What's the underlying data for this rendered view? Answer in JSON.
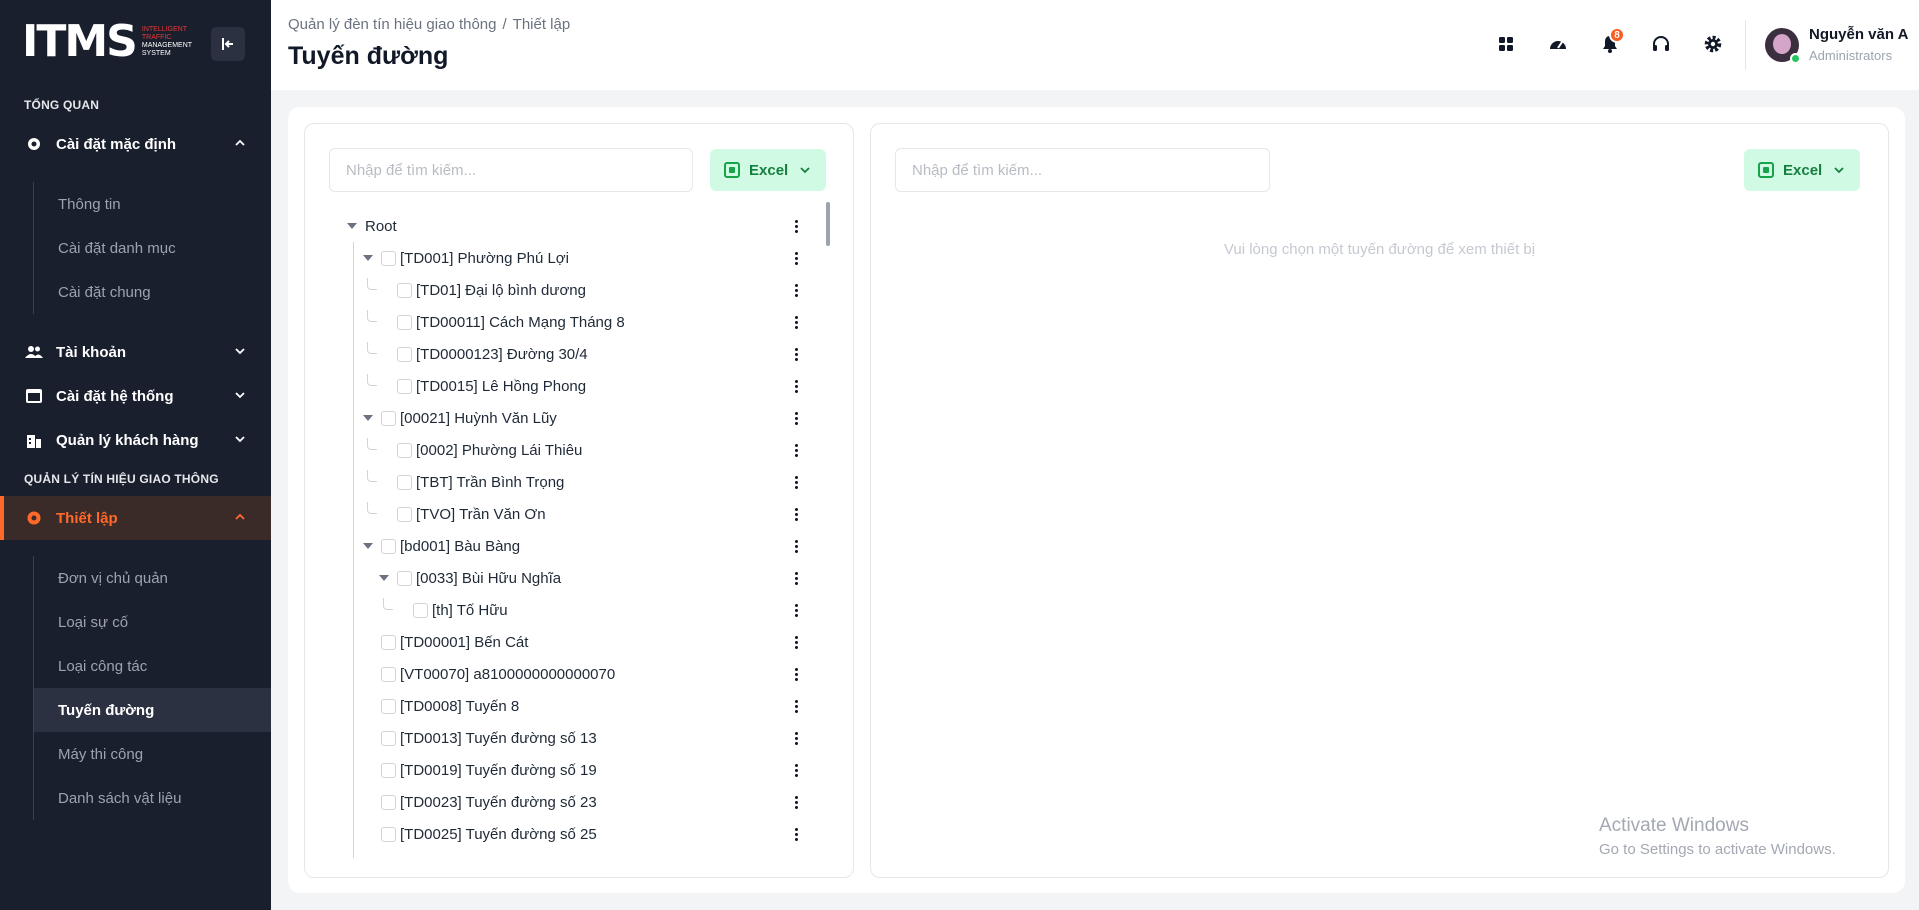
{
  "logo": {
    "text_main": "IT",
    "text_accent": "MS",
    "line1": "INTELLIGENT",
    "line2": "TRAFFIC",
    "line3": "MANAGEMENT",
    "line4": "SYSTEM"
  },
  "sidebar": {
    "section_overview": "TỔNG QUAN",
    "default_settings": "Cài đặt mặc định",
    "default_settings_items": [
      "Thông tin",
      "Cài đặt danh mục",
      "Cài đặt chung"
    ],
    "accounts": "Tài khoản",
    "system_settings": "Cài đặt hệ thống",
    "customers": "Quản lý khách hàng",
    "section_traffic": "QUẢN LÝ TÍN HIỆU GIAO THÔNG",
    "setup": "Thiết lập",
    "setup_items": [
      "Đơn vị chủ quản",
      "Loại sự cố",
      "Loại công tác",
      "Tuyến đường",
      "Máy thi công",
      "Danh sách vật liệu"
    ],
    "active_item": "Tuyến đường",
    "accent_color": "#ff6a2b"
  },
  "header": {
    "breadcrumb": [
      "Quản lý đèn tín hiệu giao thông",
      "Thiết lập"
    ],
    "breadcrumb_sep": "/",
    "title": "Tuyến đường",
    "notification_count": "8",
    "icons": [
      "apps-icon",
      "dashboard-icon",
      "bell-icon",
      "headset-icon",
      "gear-icon"
    ],
    "user_name": "Nguyễn văn A",
    "user_role": "Administrators"
  },
  "left_panel": {
    "search_placeholder": "Nhập để tìm kiếm...",
    "excel_label": "Excel",
    "tree": [
      {
        "label": "Root",
        "depth": 0,
        "expanded": true,
        "checkbox": false
      },
      {
        "label": "[TD001] Phường Phú Lợi",
        "depth": 1,
        "expanded": true,
        "checkbox": true
      },
      {
        "label": "[TD01] Đại lộ bình dương",
        "depth": 2,
        "checkbox": true
      },
      {
        "label": "[TD00011] Cách Mạng Tháng 8",
        "depth": 2,
        "checkbox": true
      },
      {
        "label": "[TD0000123] Đường 30/4",
        "depth": 2,
        "checkbox": true
      },
      {
        "label": "[TD0015] Lê Hồng Phong",
        "depth": 2,
        "checkbox": true
      },
      {
        "label": "[00021] Huỳnh Văn Lũy",
        "depth": 1,
        "expanded": true,
        "checkbox": true
      },
      {
        "label": "[0002] Phường Lái Thiêu",
        "depth": 2,
        "checkbox": true
      },
      {
        "label": "[TBT] Trần Bình Trọng",
        "depth": 2,
        "checkbox": true
      },
      {
        "label": "[TVO] Trần Văn Ơn",
        "depth": 2,
        "checkbox": true
      },
      {
        "label": "[bd001] Bàu Bàng",
        "depth": 1,
        "expanded": true,
        "checkbox": true
      },
      {
        "label": "[0033] Bùi Hữu Nghĩa",
        "depth": 2,
        "expanded": true,
        "checkbox": true
      },
      {
        "label": "[th] Tố Hữu",
        "depth": 3,
        "checkbox": true
      },
      {
        "label": "[TD00001] Bến Cát",
        "depth": 1,
        "checkbox": true
      },
      {
        "label": "[VT00070] a8100000000000070",
        "depth": 1,
        "checkbox": true
      },
      {
        "label": "[TD0008] Tuyến 8",
        "depth": 1,
        "checkbox": true
      },
      {
        "label": "[TD0013] Tuyến đường số 13",
        "depth": 1,
        "checkbox": true
      },
      {
        "label": "[TD0019] Tuyến đường số 19",
        "depth": 1,
        "checkbox": true
      },
      {
        "label": "[TD0023] Tuyến đường số 23",
        "depth": 1,
        "checkbox": true
      },
      {
        "label": "[TD0025] Tuyến đường số 25",
        "depth": 1,
        "checkbox": true
      }
    ]
  },
  "right_panel": {
    "search_placeholder": "Nhập để tìm kiếm...",
    "excel_label": "Excel",
    "empty_message": "Vui lòng chọn một tuyến đường để xem thiết bị"
  },
  "watermark": {
    "line1": "Activate Windows",
    "line2": "Go to Settings to activate Windows."
  }
}
